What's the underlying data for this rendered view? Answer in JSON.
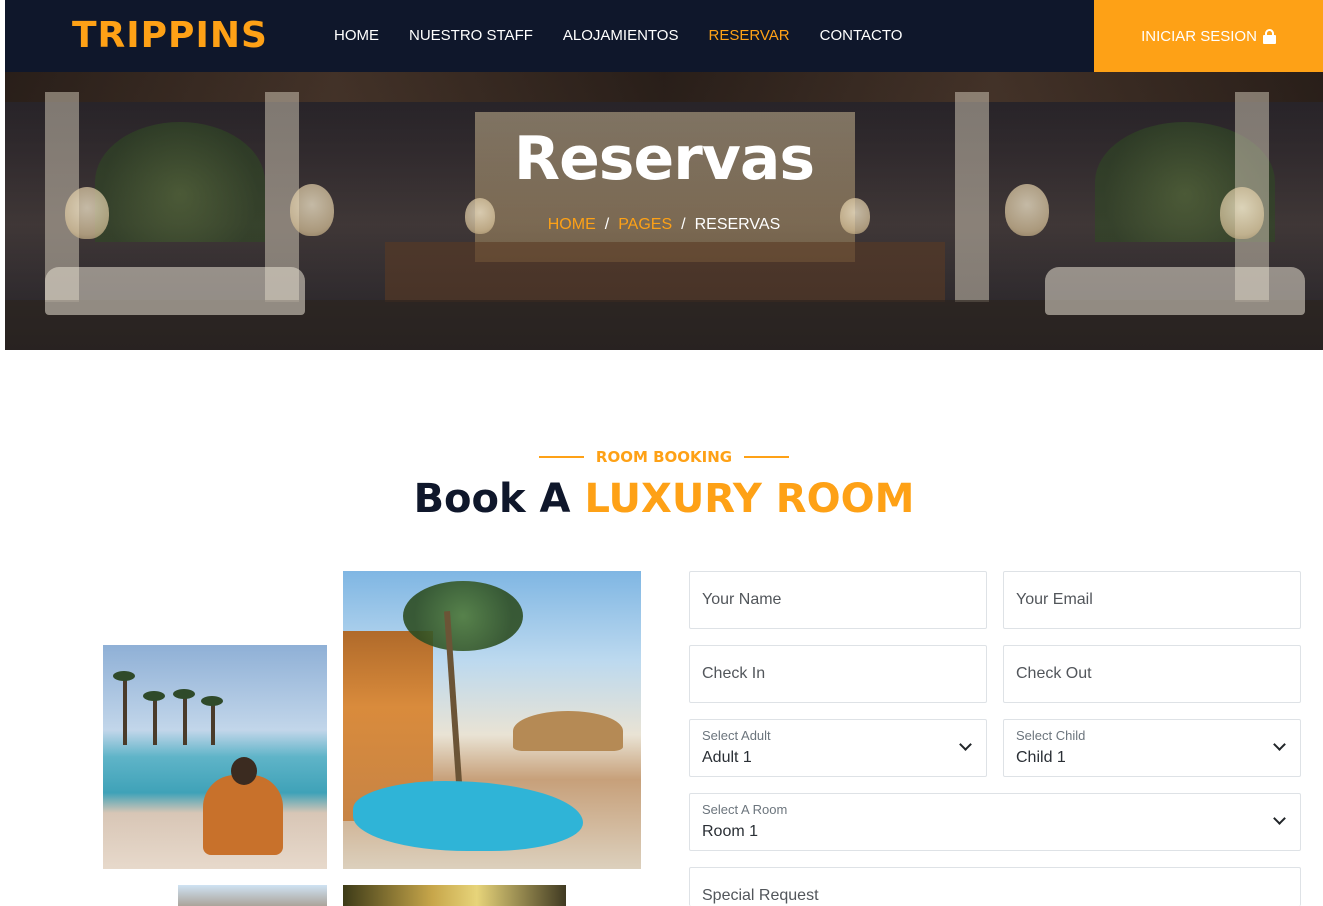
{
  "colors": {
    "primary": "#fea116",
    "dark": "#0f172b",
    "white": "#ffffff"
  },
  "navbar": {
    "brand": "TRIPPINS",
    "items": [
      {
        "label": "HOME",
        "active": false
      },
      {
        "label": "NUESTRO STAFF",
        "active": false
      },
      {
        "label": "ALOJAMIENTOS",
        "active": false
      },
      {
        "label": "RESERVAR",
        "active": true
      },
      {
        "label": "CONTACTO",
        "active": false
      }
    ],
    "login_label": "INICIAR SESION",
    "login_icon": "lock-icon"
  },
  "hero": {
    "title": "Reservas",
    "breadcrumb": [
      "HOME",
      "PAGES",
      "RESERVAS"
    ],
    "separator": "/"
  },
  "section": {
    "subtitle": "ROOM BOOKING",
    "title_prefix": "Book A",
    "title_accent": "LUXURY ROOM"
  },
  "form": {
    "name_placeholder": "Your Name",
    "email_placeholder": "Your Email",
    "checkin_placeholder": "Check In",
    "checkout_placeholder": "Check Out",
    "adult": {
      "label": "Select Adult",
      "value": "Adult 1"
    },
    "child": {
      "label": "Select Child",
      "value": "Child 1"
    },
    "room": {
      "label": "Select A Room",
      "value": "Room 1"
    },
    "request_placeholder": "Special Request"
  }
}
